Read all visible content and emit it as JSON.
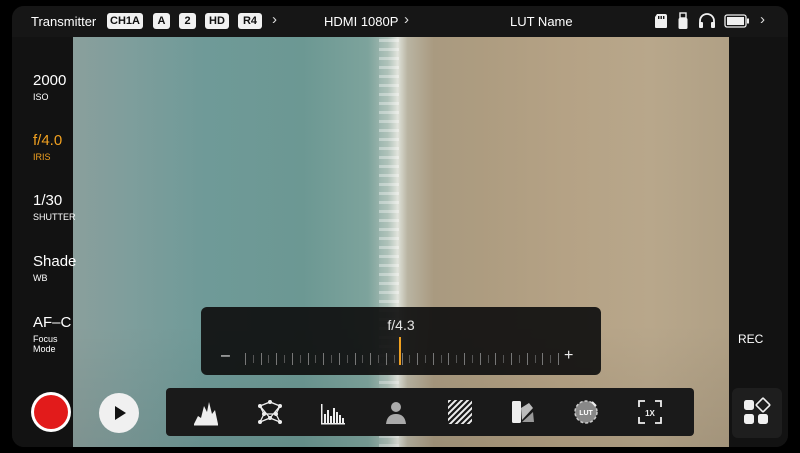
{
  "topbar": {
    "transmitter": "Transmitter",
    "badges": [
      "CH1A",
      "A",
      "2",
      "HD",
      "R4"
    ],
    "hdmi": "HDMI 1080P",
    "lut": "LUT Name",
    "chevron": "›"
  },
  "left_panel": [
    {
      "value": "2000",
      "label": "ISO",
      "active": false
    },
    {
      "value": "f/4.0",
      "label": "IRIS",
      "active": true
    },
    {
      "value": "1/30",
      "label": "SHUTTER",
      "active": false
    },
    {
      "value": "Shade",
      "label": "WB",
      "active": false
    },
    {
      "value": "AF–C",
      "label": "Focus Mode",
      "active": false
    }
  ],
  "slider": {
    "value": "f/4.3",
    "minus": "–",
    "plus": "+",
    "position": 0.5
  },
  "right_panel": {
    "rec": "REC"
  },
  "toolbar": {
    "tools": [
      "waveform-icon",
      "focus-peaking-icon",
      "histogram-icon",
      "exposure-person-icon",
      "zebra-icon",
      "false-color-icon",
      "lut-icon",
      "zoom-1x-icon"
    ],
    "zoom_label": "1X",
    "lut_label": "LUT"
  },
  "colors": {
    "accent": "#f0a020",
    "record": "#e21b1b"
  }
}
